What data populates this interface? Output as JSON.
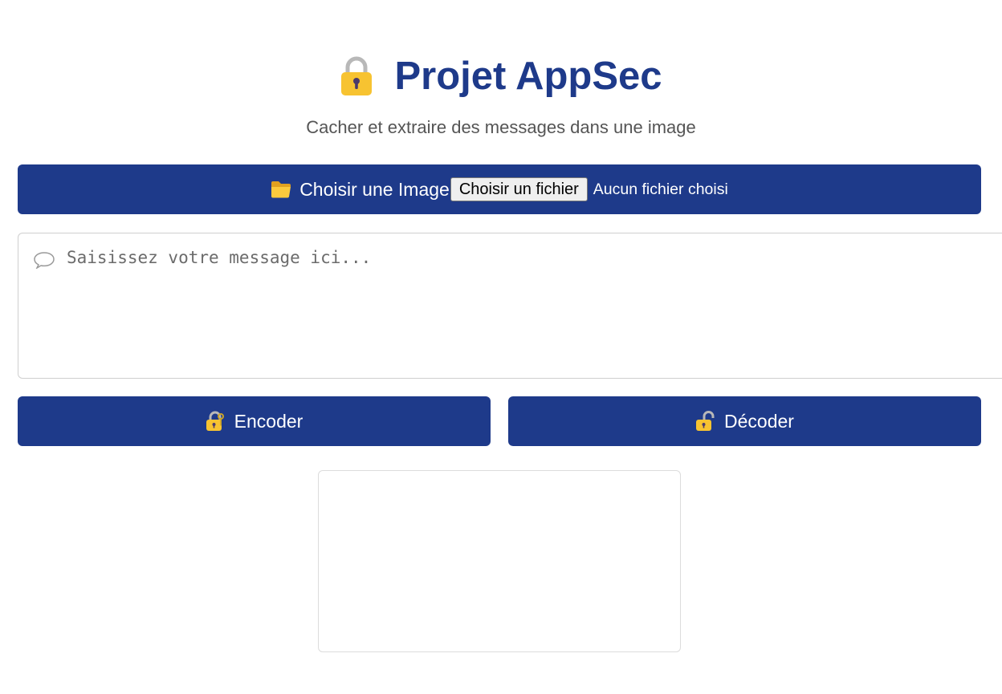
{
  "header": {
    "title": "Projet AppSec",
    "subtitle": "Cacher et extraire des messages dans une image",
    "title_icon": "lock-icon"
  },
  "file_picker": {
    "label": "Choisir une Image",
    "button_label": "Choisir un fichier",
    "status": "Aucun fichier choisi",
    "icon": "folder-icon"
  },
  "message": {
    "placeholder": "Saisissez votre message ici...",
    "value": "",
    "icon": "speech-bubble-icon"
  },
  "actions": {
    "encode_label": "Encoder",
    "encode_icon": "locked-with-key-icon",
    "decode_label": "Décoder",
    "decode_icon": "unlocked-icon"
  },
  "colors": {
    "primary": "#1e3a8a",
    "subtitle": "#555555",
    "lock_body": "#f7c331"
  }
}
